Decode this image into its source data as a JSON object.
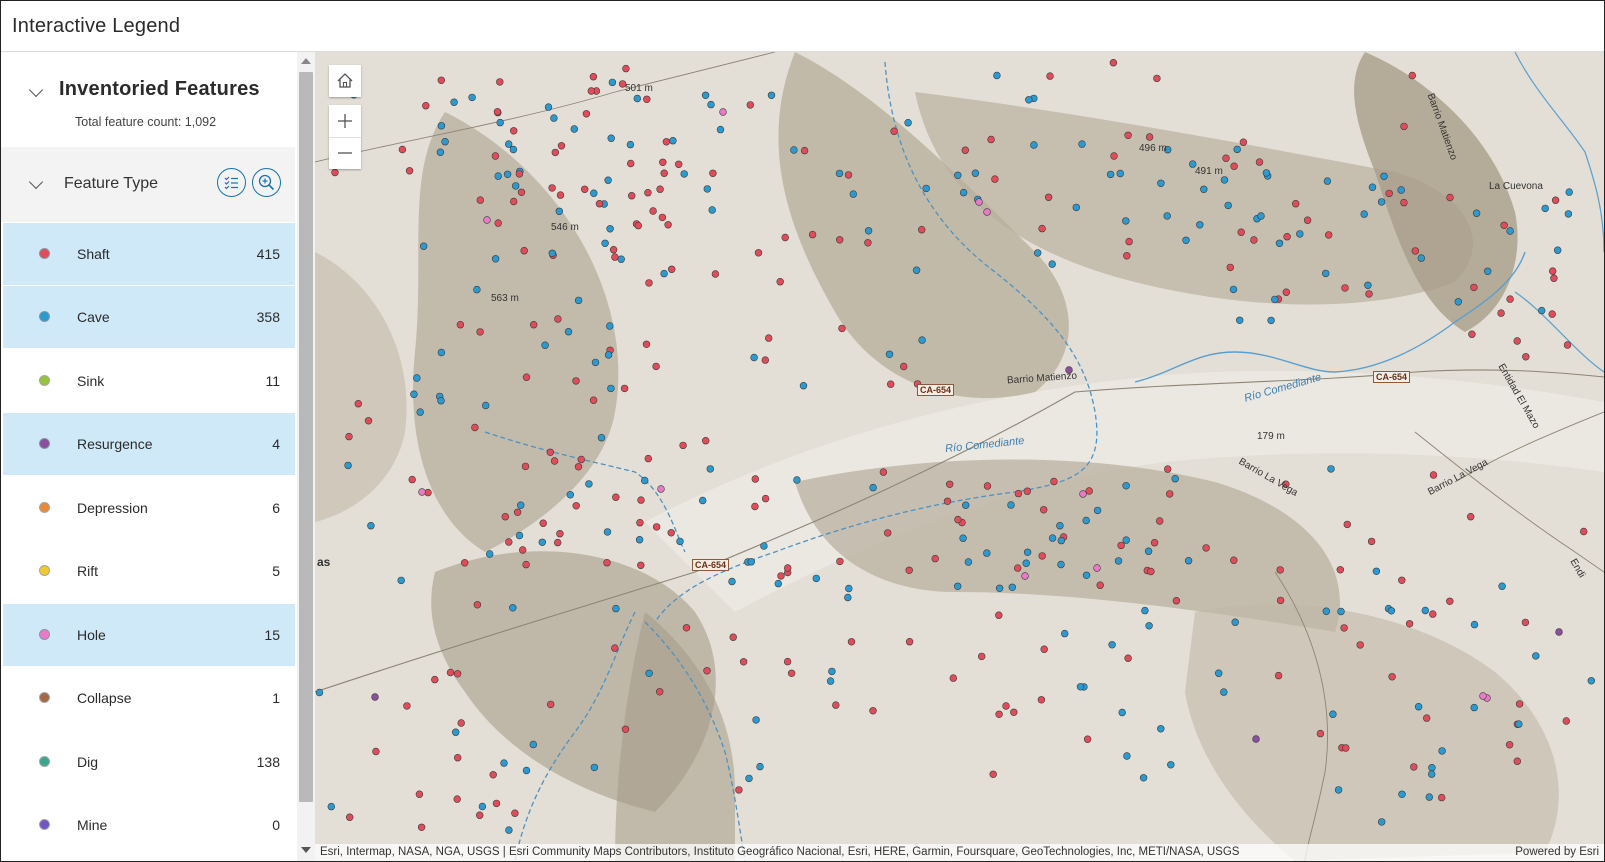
{
  "app": {
    "title": "Interactive Legend"
  },
  "panel": {
    "title": "Inventoried Features",
    "total_label": "Total feature count: 1,092",
    "group_title": "Feature Type"
  },
  "legend": [
    {
      "label": "Shaft",
      "count": "415",
      "color": "#e04c5a",
      "selected": true
    },
    {
      "label": "Cave",
      "count": "358",
      "color": "#2b9ad1",
      "selected": true
    },
    {
      "label": "Sink",
      "count": "11",
      "color": "#96c33d",
      "selected": false
    },
    {
      "label": "Resurgence",
      "count": "4",
      "color": "#8a4f9e",
      "selected": true
    },
    {
      "label": "Depression",
      "count": "6",
      "color": "#e88a3a",
      "selected": false
    },
    {
      "label": "Rift",
      "count": "5",
      "color": "#f2c830",
      "selected": false
    },
    {
      "label": "Hole",
      "count": "15",
      "color": "#e87ac8",
      "selected": true
    },
    {
      "label": "Collapse",
      "count": "1",
      "color": "#a3684a",
      "selected": false
    },
    {
      "label": "Dig",
      "count": "138",
      "color": "#3aa88e",
      "selected": false
    },
    {
      "label": "Mine",
      "count": "0",
      "color": "#6f55c6",
      "selected": false
    }
  ],
  "map": {
    "labels": {
      "elev_501": "501 m",
      "elev_546": "546 m",
      "elev_563": "563 m",
      "elev_496": "496 m",
      "elev_491": "491 m",
      "elev_179": "179 m",
      "barrio_matienzo": "Barrio Matienzo",
      "barrio_matienzo_v": "Barrio Matienzo",
      "rio_comediante_1": "Río Comediante",
      "rio_comediante_2": "Río Comediante",
      "barrio_la_vega_1": "Barrio La Vega",
      "barrio_la_vega_2": "Barrio La Vega",
      "la_cuevona": "La Cuevona",
      "entidad": "Entidad El Mazo",
      "road_1": "CA-654",
      "road_2": "CA-654",
      "road_3": "CA-654",
      "as": "as",
      "endi": "Endi"
    },
    "controls": [
      "home-icon",
      "zoom-in-icon",
      "zoom-out-icon"
    ],
    "attribution": "Esri, Intermap, NASA, NGA, USGS | Esri Community Maps Contributors, Instituto Geográfico Nacional, Esri, HERE, Garmin, Foursquare, GeoTechnologies, Inc, METI/NASA, USGS",
    "powered_by": "Powered by Esri"
  }
}
